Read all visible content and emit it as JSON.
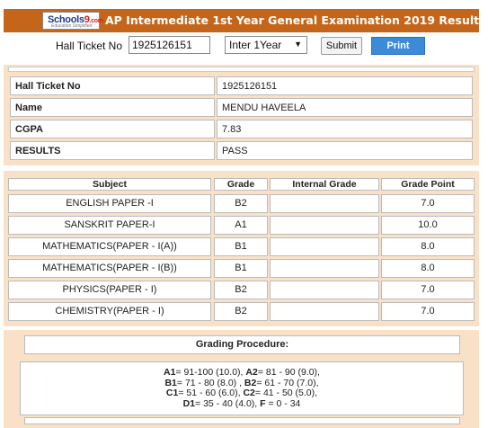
{
  "header": {
    "logo_main": "Schools",
    "logo_nine": "9",
    "logo_dot": ".com",
    "logo_tag": "Education Simplified",
    "title": "AP Intermediate 1st Year General Examination 2019 Results",
    "bg_color": "#c5651a"
  },
  "form": {
    "ticket_label": "Hall Ticket No",
    "ticket_value": "1925126151",
    "year_selected": "Inter 1Year",
    "submit_label": "Submit",
    "print_label": "Print"
  },
  "student": {
    "rows": [
      {
        "key": "Hall Ticket No",
        "value": "1925126151"
      },
      {
        "key": "Name",
        "value": "MENDU HAVEELA"
      },
      {
        "key": "CGPA",
        "value": "7.83"
      },
      {
        "key": "RESULTS",
        "value": "PASS"
      }
    ]
  },
  "grades": {
    "headers": [
      "Subject",
      "Grade",
      "Internal Grade",
      "Grade Point"
    ],
    "rows": [
      {
        "subject": "ENGLISH PAPER -I",
        "grade": "B2",
        "internal": "",
        "point": "7.0"
      },
      {
        "subject": "SANSKRIT PAPER-I",
        "grade": "A1",
        "internal": "",
        "point": "10.0"
      },
      {
        "subject": "MATHEMATICS(PAPER - I(A))",
        "grade": "B1",
        "internal": "",
        "point": "8.0"
      },
      {
        "subject": "MATHEMATICS(PAPER - I(B))",
        "grade": "B1",
        "internal": "",
        "point": "8.0"
      },
      {
        "subject": "PHYSICS(PAPER - I)",
        "grade": "B2",
        "internal": "",
        "point": "7.0"
      },
      {
        "subject": "CHEMISTRY(PAPER - I)",
        "grade": "B2",
        "internal": "",
        "point": "7.0"
      }
    ]
  },
  "procedure": {
    "title": "Grading Procedure:",
    "a1": "A1",
    "a1_text": "= 91-100 (10.0), ",
    "a2": "A2",
    "a2_text": "= 81 - 90 (9.0),",
    "b1": "B1",
    "b1_text": "= 71 - 80 (8.0) , ",
    "b2": "B2",
    "b2_text": "= 61 - 70 (7.0),",
    "c1": "C1",
    "c1_text": "= 51 - 60 (6.0), ",
    "c2": "C2",
    "c2_text": "= 41 - 50 (5.0),",
    "d1": "D1",
    "d1_text": "= 35 - 40 (4.0), ",
    "f": "F",
    "f_text": " = 0 - 34"
  }
}
